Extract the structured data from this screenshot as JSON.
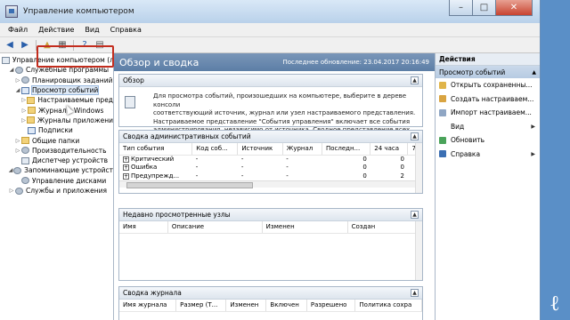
{
  "window": {
    "title": "Управление компьютером"
  },
  "menu": [
    "Файл",
    "Действие",
    "Вид",
    "Справка"
  ],
  "tree": {
    "items": [
      {
        "label": "Управление компьютером (л",
        "indent": 0,
        "exp": "",
        "icon": "computer"
      },
      {
        "label": "Служебные программы",
        "indent": 1,
        "exp": "◢",
        "icon": "gear"
      },
      {
        "label": "Планировщик заданий",
        "indent": 2,
        "exp": "▷",
        "icon": "gear"
      },
      {
        "label": "Просмотр событий",
        "indent": 2,
        "exp": "◢",
        "icon": "log",
        "selected": true
      },
      {
        "label": "Настраиваемые пред",
        "indent": 3,
        "exp": "▷",
        "icon": "folder"
      },
      {
        "label": "Журналы Windows",
        "indent": 3,
        "exp": "▷",
        "icon": "folder"
      },
      {
        "label": "Журналы приложени",
        "indent": 3,
        "exp": "▷",
        "icon": "folder"
      },
      {
        "label": "Подписки",
        "indent": 3,
        "exp": "",
        "icon": "log"
      },
      {
        "label": "Общие папки",
        "indent": 2,
        "exp": "▷",
        "icon": "folder"
      },
      {
        "label": "Производительность",
        "indent": 2,
        "exp": "▷",
        "icon": "gear"
      },
      {
        "label": "Диспетчер устройств",
        "indent": 2,
        "exp": "",
        "icon": "computer"
      },
      {
        "label": "Запоминающие устройст",
        "indent": 1,
        "exp": "◢",
        "icon": "gear"
      },
      {
        "label": "Управление дисками",
        "indent": 2,
        "exp": "",
        "icon": "gear"
      },
      {
        "label": "Службы и приложения",
        "indent": 1,
        "exp": "▷",
        "icon": "gear"
      }
    ]
  },
  "center": {
    "title": "Обзор и сводка",
    "updated": "Последнее обновление: 23.04.2017 20:16:49",
    "overview": {
      "header": "Обзор",
      "text_lines": [
        "Для просмотра событий, произошедших на компьютере, выберите в дереве консоли",
        "соответствующий источник, журнал или узел настраиваемого представления.",
        "Настраиваемое представление \"События управления\" включает все события",
        "администрирования, независимо от источника. Сводное представление всех"
      ]
    },
    "admin_summary": {
      "header": "Сводка административных событий",
      "columns": [
        "Тип события",
        "Код соб...",
        "Источник",
        "Журнал",
        "Последн...",
        "24 часа",
        "7"
      ],
      "rows": [
        {
          "type": "Критический",
          "code": "-",
          "source": "-",
          "log": "-",
          "last": "0",
          "day": "0"
        },
        {
          "type": "Ошибка",
          "code": "-",
          "source": "-",
          "log": "-",
          "last": "0",
          "day": "0"
        },
        {
          "type": "Предупрежд...",
          "code": "-",
          "source": "-",
          "log": "-",
          "last": "0",
          "day": "2"
        }
      ]
    },
    "recent_nodes": {
      "header": "Недавно просмотренные узлы",
      "columns": [
        "Имя",
        "Описание",
        "Изменен",
        "Создан"
      ]
    },
    "log_summary": {
      "header": "Сводка журнала",
      "columns": [
        "Имя журнала",
        "Размер (Т...",
        "Изменен",
        "Включен",
        "Разрешено",
        "Политика сохра"
      ]
    }
  },
  "actions": {
    "header": "Действия",
    "sub": "Просмотр событий",
    "items": [
      {
        "label": "Открыть сохраненны...",
        "icon_color": "#e0b54a",
        "arrow": ""
      },
      {
        "label": "Создать настраиваем...",
        "icon_color": "#d9a441",
        "arrow": ""
      },
      {
        "label": "Импорт настраиваем...",
        "icon_color": "#8fa6c4",
        "arrow": ""
      },
      {
        "label": "Вид",
        "icon_color": "",
        "arrow": "▶"
      },
      {
        "label": "Обновить",
        "icon_color": "#4aa35a",
        "arrow": ""
      },
      {
        "label": "Справка",
        "icon_color": "#3b6fb3",
        "arrow": "▶"
      }
    ]
  }
}
